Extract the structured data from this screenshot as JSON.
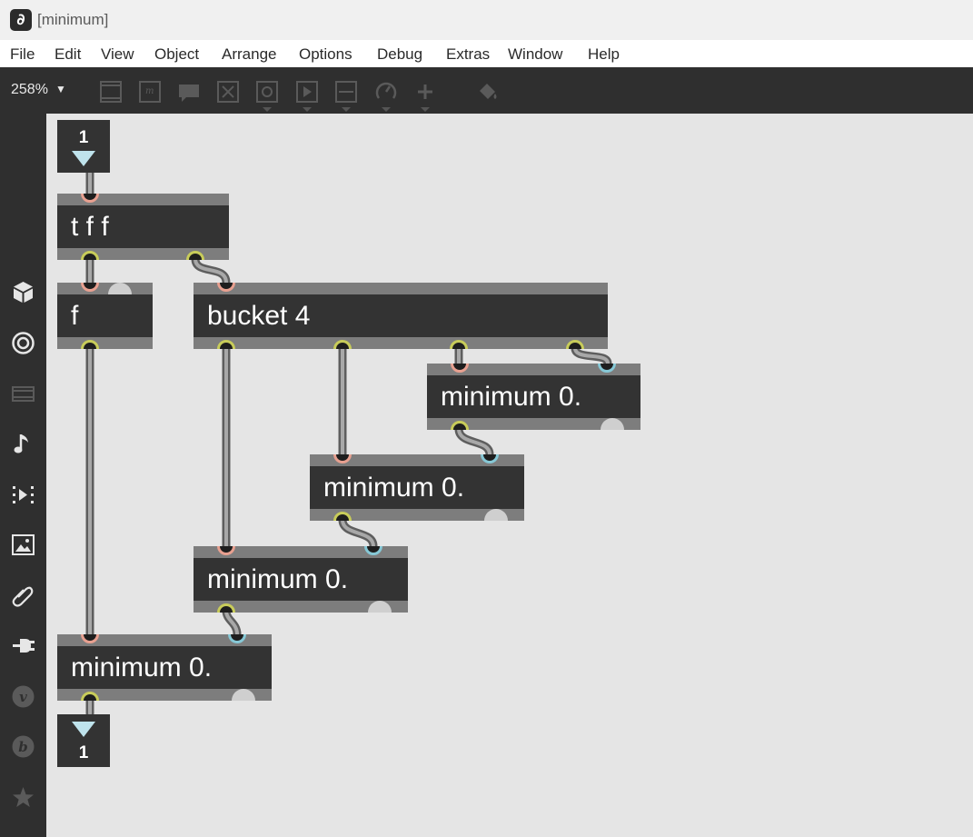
{
  "window": {
    "title": "[minimum]",
    "app_icon": "max-app-icon"
  },
  "menubar": {
    "items": [
      "File",
      "Edit",
      "View",
      "Object",
      "Arrange",
      "Options",
      "Debug",
      "Extras",
      "Window",
      "Help"
    ]
  },
  "toolbar": {
    "zoom": "258%",
    "icons": [
      "newobject-icon",
      "message-icon",
      "comment-icon",
      "toggle-icon",
      "button-icon",
      "playbar-icon",
      "slider-icon",
      "dial-icon",
      "plus-icon",
      "paint-bucket-icon"
    ]
  },
  "sidebar": {
    "icons": [
      "package-icon",
      "target-icon",
      "video-icon",
      "music-note-icon",
      "media-play-icon",
      "image-icon",
      "paperclip-icon",
      "plug-icon",
      "vizzie-icon",
      "beap-icon",
      "star-icon"
    ]
  },
  "patcher": {
    "inlet_number": {
      "value": "1"
    },
    "outlet_number": {
      "value": "1"
    },
    "objects": {
      "trigger": "t f f",
      "float": "f",
      "bucket": "bucket 4",
      "minimum_a": "minimum 0.",
      "minimum_b": "minimum 0.",
      "minimum_c": "minimum 0.",
      "minimum_d": "minimum 0."
    }
  },
  "colors": {
    "hot_inlet": "#e8a090",
    "cold_inlet": "#86c8d6",
    "outlet": "#c8cc5a",
    "object_body": "#333333",
    "object_frame": "#7d7d7d",
    "canvas": "#e5e5e5",
    "toolbar": "#2f2f2f"
  }
}
